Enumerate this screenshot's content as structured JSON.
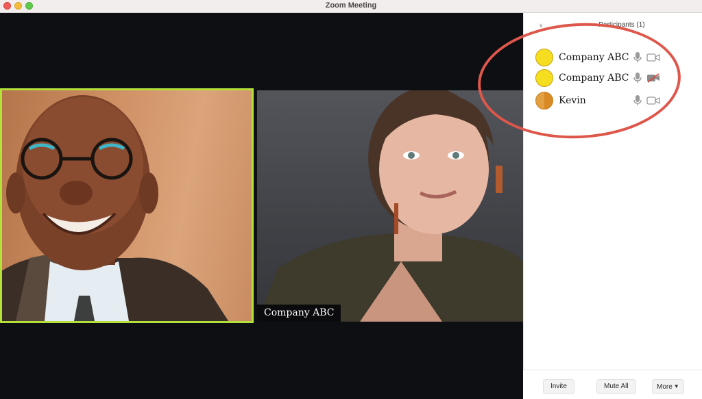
{
  "window": {
    "title": "Zoom Meeting"
  },
  "video_tiles": [
    {
      "id": "tile-1",
      "active_speaker": true,
      "label": ""
    },
    {
      "id": "tile-2",
      "active_speaker": false,
      "label": "Company ABC"
    }
  ],
  "participants_panel": {
    "title": "Participants (1)",
    "items": [
      {
        "name": "Company ABC",
        "avatar_color": "#f5de1f",
        "mic": "on",
        "video": "on"
      },
      {
        "name": "Company ABC",
        "avatar_color": "#f5de1f",
        "mic": "on",
        "video": "off"
      },
      {
        "name": "Kevin",
        "avatar_color": "#e79a2e",
        "mic": "on",
        "video": "on"
      }
    ]
  },
  "footer": {
    "invite_label": "Invite",
    "mute_all_label": "Mute All",
    "more_label": "More"
  },
  "colors": {
    "active_speaker_border": "#b4e03a",
    "annotation_ring": "#de574b",
    "video_background": "#0e0f13"
  }
}
